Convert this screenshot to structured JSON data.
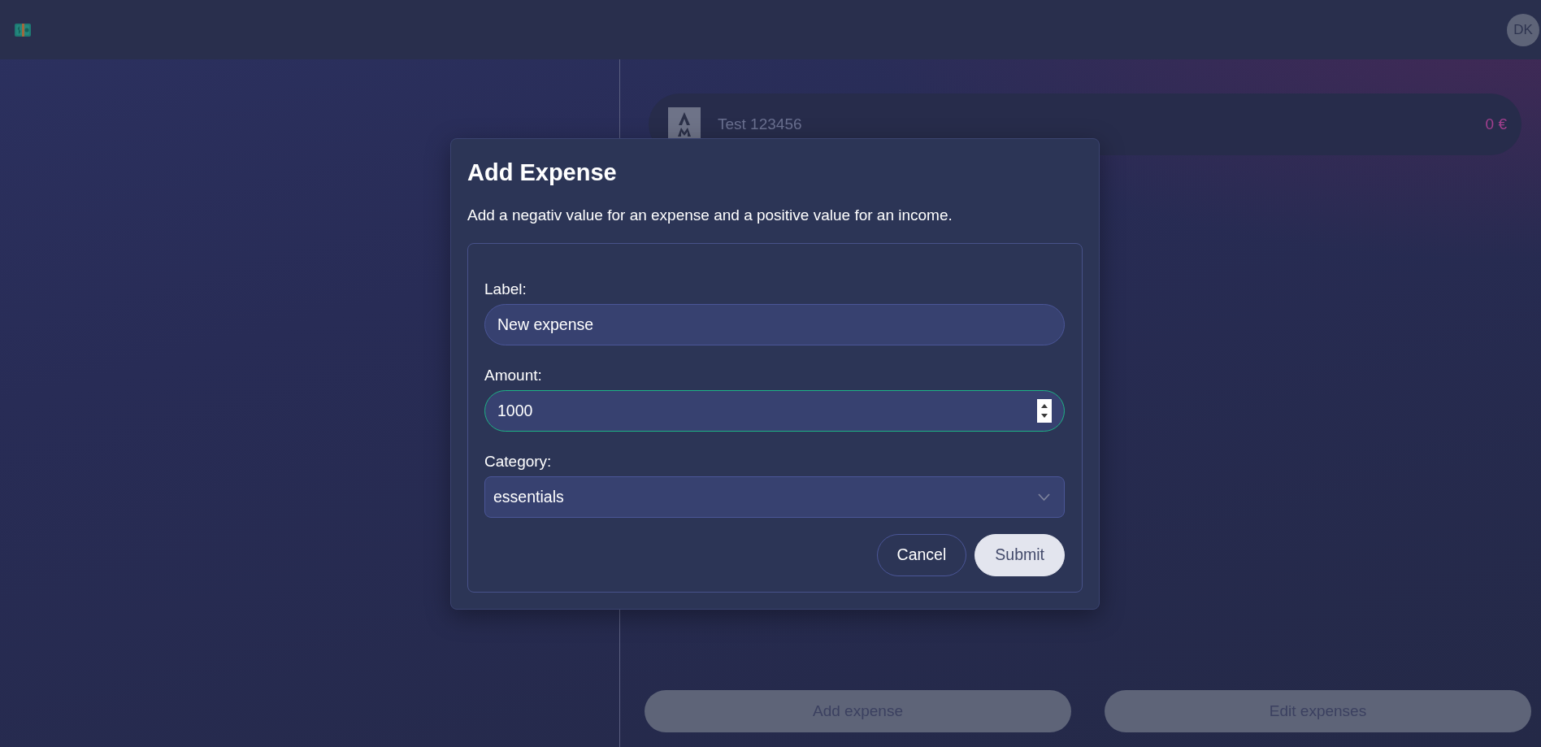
{
  "header": {
    "avatar_initials": "DK"
  },
  "expenses": [
    {
      "label": "Test 123456",
      "amount": "0 €"
    }
  ],
  "actions": [
    {
      "label": "Add expense"
    },
    {
      "label": "Edit expenses"
    }
  ],
  "dialog": {
    "title": "Add Expense",
    "description": "Add a negativ value for an expense and a positive value for an income.",
    "fields": [
      {
        "kind": "text",
        "label": "Label:",
        "value": "New expense",
        "focused": false
      },
      {
        "kind": "number",
        "label": "Amount:",
        "value": "1000",
        "focused": true
      },
      {
        "kind": "select",
        "label": "Category:",
        "value": "essentials",
        "focused": false
      }
    ],
    "buttons": [
      {
        "kind": "cancel",
        "label": "Cancel"
      },
      {
        "kind": "submit",
        "label": "Submit"
      }
    ]
  }
}
